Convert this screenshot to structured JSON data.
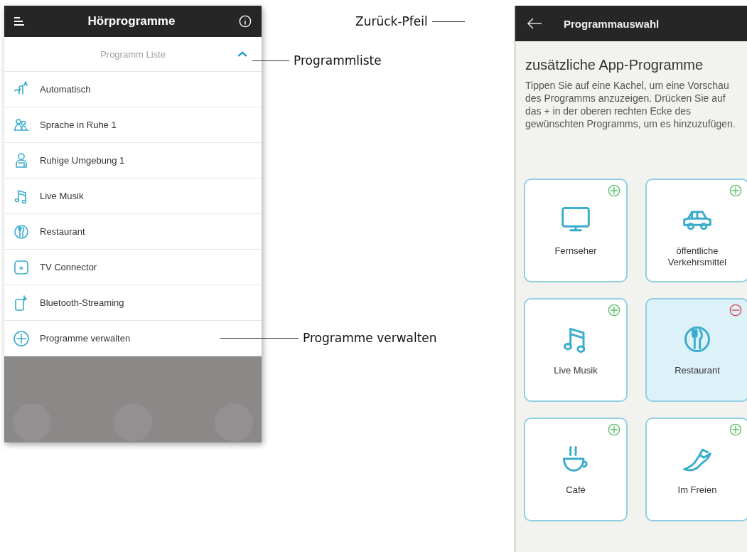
{
  "left_screen": {
    "header": {
      "title": "Hörprogramme"
    },
    "list_header": {
      "title": "Programm Liste",
      "expanded": true
    },
    "programs": [
      {
        "label": "Automatisch",
        "kind": "auto"
      },
      {
        "label": "Sprache in Ruhe 1",
        "kind": "speech"
      },
      {
        "label": "Ruhige Umgebung 1",
        "kind": "quiet"
      },
      {
        "label": "Live Musik",
        "kind": "music"
      },
      {
        "label": "Restaurant",
        "kind": "restaurant"
      },
      {
        "label": "TV Connector",
        "kind": "tv-connector"
      },
      {
        "label": "Bluetooth-Streaming",
        "kind": "phone"
      },
      {
        "label": "Programme verwalten",
        "kind": "add"
      }
    ]
  },
  "right_screen": {
    "header": {
      "title": "Programmauswahl"
    },
    "heading": "zusätzliche App-Programme",
    "description": "Tippen Sie auf eine Kachel, um eine Vorschau des Programms anzuzeigen. Drücken Sie auf das + in der oberen rechten Ecke des gewünschten Programms, um es hinzuzufügen.",
    "tiles": [
      {
        "label": "Fernseher",
        "kind": "tv",
        "selected": false
      },
      {
        "label": "öffentliche Verkehrsmittel",
        "kind": "car",
        "selected": false
      },
      {
        "label": "Live Musik",
        "kind": "music",
        "selected": false
      },
      {
        "label": "Restaurant",
        "kind": "restaurant",
        "selected": true
      },
      {
        "label": "Café",
        "kind": "cafe",
        "selected": false
      },
      {
        "label": "Im Freien",
        "kind": "shoe",
        "selected": false
      }
    ]
  },
  "callouts": [
    {
      "label": "Zurück-Pfeil",
      "kind": "back"
    },
    {
      "label": "Programmliste",
      "kind": "list"
    },
    {
      "label": "Programme verwalten",
      "kind": "manage"
    }
  ]
}
